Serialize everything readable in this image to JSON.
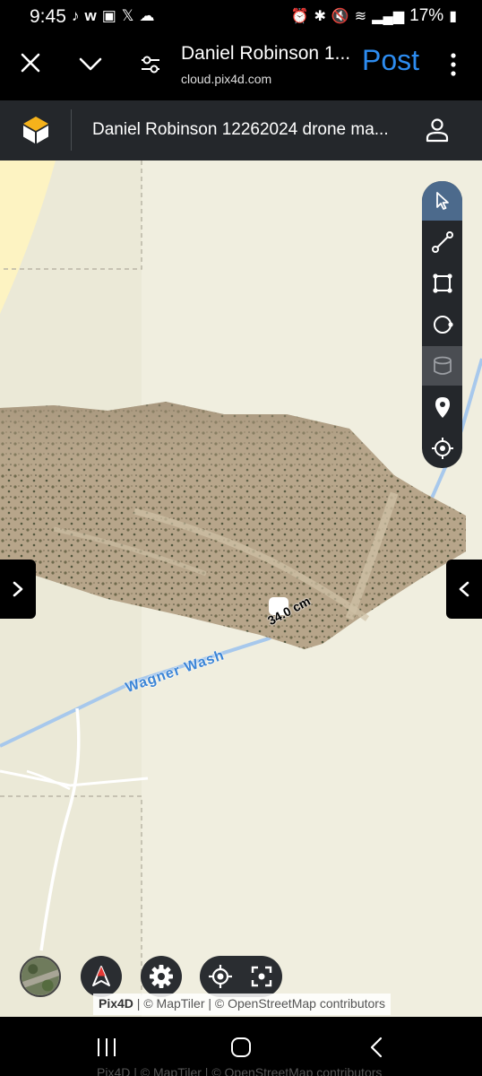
{
  "status_bar": {
    "time": "9:45",
    "left_icons": [
      "tiktok-icon",
      "w-icon",
      "image-icon",
      "x-icon",
      "cloud-icon"
    ],
    "battery": "17%"
  },
  "browser": {
    "title": "Daniel Robinson 1...",
    "url": "cloud.pix4d.com",
    "post_label": "Post"
  },
  "app": {
    "project_title": "Daniel Robinson 12262024 drone ma..."
  },
  "toolbar": {
    "tools": [
      {
        "name": "select-tool",
        "icon": "cursor-icon",
        "state": "active"
      },
      {
        "name": "distance-tool",
        "icon": "line-measure-icon",
        "state": "normal"
      },
      {
        "name": "area-tool",
        "icon": "polygon-icon",
        "state": "normal"
      },
      {
        "name": "circle-tool",
        "icon": "circle-measure-icon",
        "state": "normal"
      },
      {
        "name": "volume-tool",
        "icon": "volume-icon",
        "state": "disabled"
      },
      {
        "name": "marker-tool",
        "icon": "map-pin-icon",
        "state": "normal"
      },
      {
        "name": "locate-point-tool",
        "icon": "crosshair-icon",
        "state": "normal"
      }
    ]
  },
  "map": {
    "measurement_label": "34.0 cm",
    "water_label": "Wagner Wash",
    "colors": {
      "background": "#f0eedf",
      "water": "#a7c8ec",
      "yellow_area": "#fdf3c2"
    }
  },
  "attribution": {
    "brand": "Pix4D",
    "rest": " | © MapTiler | © OpenStreetMap contributors",
    "ghost": "Pix4D | © MapTiler | © OpenStreetMap contributors"
  },
  "colors": {
    "accent": "#2d8cf0",
    "header_bg": "#24272b",
    "active_tool": "#4c6a8c"
  }
}
